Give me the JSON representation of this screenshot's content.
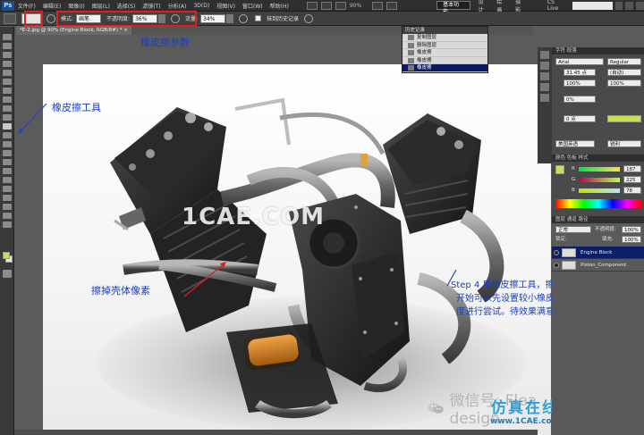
{
  "app": {
    "logo": "Ps"
  },
  "menubar": {
    "items": [
      "文件(F)",
      "编辑(E)",
      "图像(I)",
      "图层(L)",
      "选择(S)",
      "滤镜(T)",
      "分析(A)",
      "3D(D)",
      "视图(V)",
      "窗口(W)",
      "帮助(H)"
    ],
    "zoom": "90%",
    "workspace": "基本功能",
    "workspace_items": [
      "设计",
      "绘画",
      "摄影"
    ],
    "cslive": "CS Live"
  },
  "options": {
    "mode_label": "模式:",
    "mode_value": "画笔",
    "opacity_label": "不透明度:",
    "opacity_value": "36%",
    "flow_label": "流量:",
    "flow_value": "34%",
    "erase_history_label": "抹到历史记录"
  },
  "document": {
    "tab_title": "*E-2.jpg @ 90% (Engine Block, RGB/8#) * ×"
  },
  "history": {
    "title": "历史记录",
    "items": [
      {
        "label": "复制图层",
        "selected": false
      },
      {
        "label": "删除图层",
        "selected": false
      },
      {
        "label": "橡皮擦",
        "selected": false
      },
      {
        "label": "橡皮擦",
        "selected": false
      },
      {
        "label": "橡皮擦",
        "selected": false
      },
      {
        "label": "橡皮擦",
        "selected": true
      }
    ]
  },
  "annotations": {
    "eraser_params": "橡皮擦参数",
    "eraser_tool": "橡皮擦工具",
    "erase_shell": "擦掉壳体像素",
    "step": [
      "Step 4 用橡皮擦工具，擦掉外壳像素，",
      "开始可以先设置较小橡皮擦流量、透明",
      "度进行尝试。待效果满意后，大面积操作。"
    ]
  },
  "watermarks": {
    "center": "1CAE.COM",
    "wechat": "微信号: Flea design",
    "site_cn": "仿真在线",
    "site_en": "www.1CAE.com"
  },
  "character_panel": {
    "tabs": "字符  段落",
    "font": "Arial",
    "style": "Regular",
    "size": "31.45 点",
    "leading": "(自动)",
    "tracking": "100%",
    "vscale": "100%",
    "kerning": "0%",
    "baseline": "0 点",
    "language": "美国英语",
    "aa": "锐利"
  },
  "color_panel": {
    "tabs": "颜色  色板  样式",
    "r_label": "R",
    "g_label": "G",
    "b_label": "B",
    "r_value": "187",
    "g_value": "225",
    "b_value": "78",
    "swatch_color": "#c9e04e"
  },
  "layers_panel": {
    "tabs": "图层  通道  路径",
    "blend_mode": "正常",
    "opacity_label": "不透明度:",
    "opacity_value": "100%",
    "lock_label": "锁定:",
    "fill_label": "填充:",
    "fill_value": "100%",
    "layers": [
      {
        "name": "Engine Block",
        "selected": true
      },
      {
        "name": "Piston_Component",
        "selected": false
      }
    ]
  },
  "colors": {
    "annotation_blue": "#1a3fbf",
    "highlight_red": "#e02020",
    "history_selected": "#0a1c5e"
  }
}
